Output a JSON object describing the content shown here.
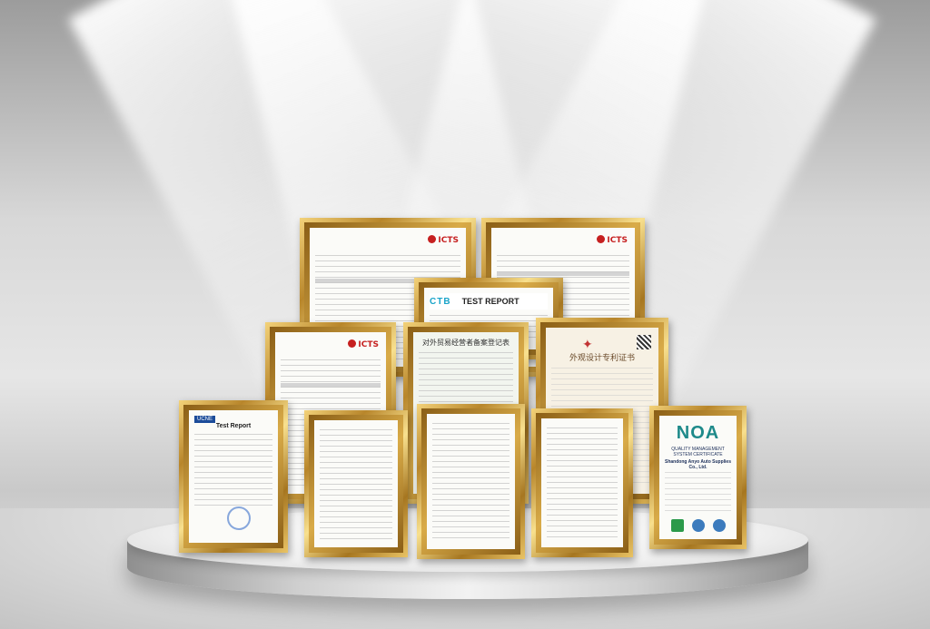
{
  "scene": {
    "background_color": "#d8d8d8",
    "frame_color": "#c9982f"
  },
  "certificates": {
    "icts_logo": "ICTS",
    "ctb_logo": "CTB",
    "ctb_title": "TEST REPORT",
    "cn_record_title": "对外贸易经营者备案登记表",
    "patent_title": "外观设计专利证书",
    "ucne_logo": "UCNE",
    "test_report_title": "Test Report",
    "noa_logo": "NOA",
    "noa_title": "QUALITY MANAGEMENT SYSTEM CERTIFICATE",
    "noa_company": "Shandong Anyo Auto Supplies Co., Ltd."
  }
}
